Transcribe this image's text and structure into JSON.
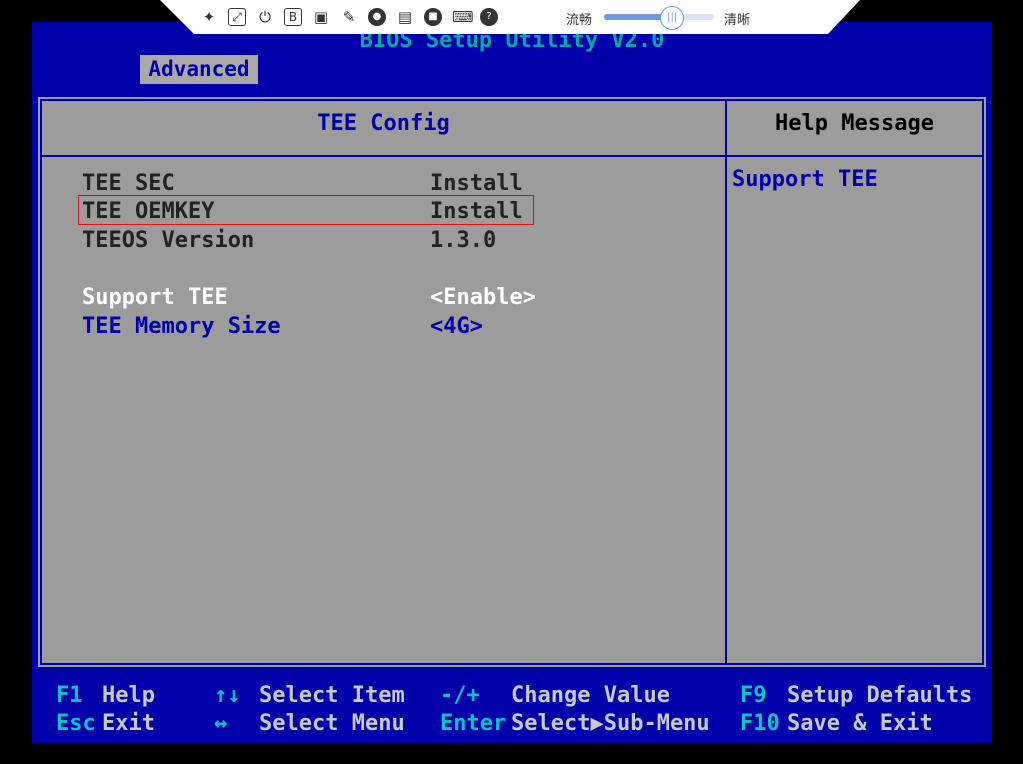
{
  "toolbar": {
    "icons": [
      "pin-icon",
      "fullscreen-icon",
      "power-icon",
      "b-icon",
      "keyboard-lock-icon",
      "mouse-icon",
      "record-icon",
      "save-icon",
      "video-icon",
      "keyboard-icon",
      "help-icon"
    ],
    "fluent_label": "流畅",
    "clear_label": "清晰",
    "quality_level": 0.62
  },
  "bios": {
    "title": "BIOS Setup Utility V2.0",
    "tab": "Advanced",
    "page_title": "TEE Config",
    "help_title": "Help Message",
    "help_text": "Support TEE",
    "rows": [
      {
        "label": "TEE SEC",
        "value": "Install"
      },
      {
        "label": "TEE OEMKEY",
        "value": "Install"
      },
      {
        "label": "TEEOS Version",
        "value": "1.3.0"
      },
      {
        "label": "Support TEE",
        "value": "<Enable>"
      },
      {
        "label": "TEE Memory Size",
        "value": "<4G>"
      }
    ],
    "footer": {
      "f1_key": "F1",
      "f1_desc": "Help",
      "updown_key": "↑↓",
      "updown_desc": "Select Item",
      "change_key": "-/+",
      "change_desc": "Change Value",
      "f9_key": "F9",
      "f9_desc": "Setup Defaults",
      "esc_key": "Esc",
      "esc_desc": "Exit",
      "leftright_key": "↔",
      "leftright_desc": "Select Menu",
      "enter_key": "Enter",
      "enter_desc": "Select▶Sub-Menu",
      "f10_key": "F10",
      "f10_desc": "Save & Exit"
    }
  },
  "colors": {
    "bios_blue": "#0000aa",
    "panel_gray": "#9c9c9c",
    "selected_white": "#ffffff",
    "footer_key_cyan": "#00c8c8",
    "highlight_red": "#e01010"
  }
}
